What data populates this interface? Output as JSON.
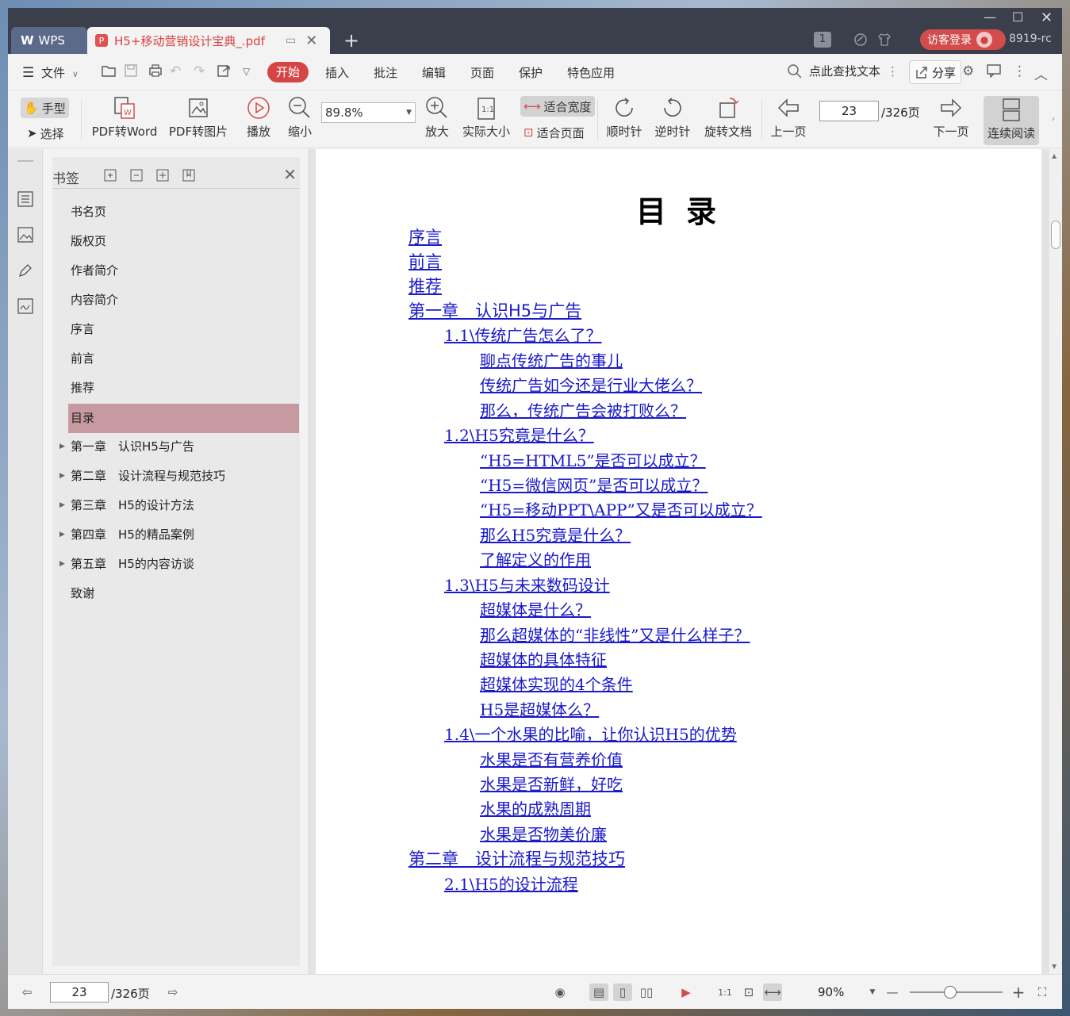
{
  "window": {
    "app_tab": "WPS",
    "doc_tab": "H5+移动营销设计宝典_.pdf",
    "new_tab": "+",
    "badge": "1",
    "login": "访客登录",
    "user_id": "8919-rc"
  },
  "menu": {
    "file": "文件",
    "items": [
      "开始",
      "插入",
      "批注",
      "编辑",
      "页面",
      "保护",
      "特色应用"
    ],
    "search": "点此查找文本",
    "share": "分享"
  },
  "toolbar": {
    "hand": "手型",
    "select": "选择",
    "pdf_to_word": "PDF转Word",
    "pdf_to_image": "PDF转图片",
    "play": "播放",
    "zoom_out": "缩小",
    "zoom_value": "89.8%",
    "zoom_in": "放大",
    "actual_size": "实际大小",
    "fit_width": "适合宽度",
    "fit_page": "适合页面",
    "rotate_cw": "顺时针",
    "rotate_ccw": "逆时针",
    "rotate_doc": "旋转文档",
    "prev_page": "上一页",
    "page_current": "23",
    "page_total": "/326页",
    "next_page": "下一页",
    "continuous": "连续阅读"
  },
  "bookmarks": {
    "title": "书签",
    "items": [
      {
        "label": "书名页"
      },
      {
        "label": "版权页"
      },
      {
        "label": "作者简介"
      },
      {
        "label": "内容简介"
      },
      {
        "label": "序言"
      },
      {
        "label": "前言"
      },
      {
        "label": "推荐"
      },
      {
        "label": "目录"
      },
      {
        "label": "第一章　认识H5与广告"
      },
      {
        "label": "第二章　设计流程与规范技巧"
      },
      {
        "label": "第三章　H5的设计方法"
      },
      {
        "label": "第四章　H5的精品案例"
      },
      {
        "label": "第五章　H5的内容访谈"
      },
      {
        "label": "致谢"
      }
    ]
  },
  "document": {
    "title": "目 录",
    "toc": [
      {
        "text": "序言"
      },
      {
        "text": "前言"
      },
      {
        "text": "推荐"
      },
      {
        "text": "第一章　认识H5与广告"
      },
      {
        "text": "1.1\\传统广告怎么了？"
      },
      {
        "text": "聊点传统广告的事儿"
      },
      {
        "text": "传统广告如今还是行业大佬么？"
      },
      {
        "text": "那么，传统广告会被打败么？"
      },
      {
        "text": "1.2\\H5究竟是什么？"
      },
      {
        "text": "“H5=HTML5”是否可以成立？"
      },
      {
        "text": "“H5=微信网页”是否可以成立？"
      },
      {
        "text": "“H5=移动PPT\\APP”又是否可以成立？"
      },
      {
        "text": "那么H5究竟是什么？"
      },
      {
        "text": "了解定义的作用"
      },
      {
        "text": "1.3\\H5与未来数码设计"
      },
      {
        "text": "超媒体是什么？"
      },
      {
        "text": "那么超媒体的“非线性”又是什么样子？"
      },
      {
        "text": "超媒体的具体特征"
      },
      {
        "text": "超媒体实现的4个条件"
      },
      {
        "text": "H5是超媒体么？"
      },
      {
        "text": "1.4\\一个水果的比喻，让你认识H5的优势"
      },
      {
        "text": "水果是否有营养价值"
      },
      {
        "text": "水果是否新鲜，好吃"
      },
      {
        "text": "水果的成熟周期"
      },
      {
        "text": "水果是否物美价廉"
      },
      {
        "text": "第二章　设计流程与规范技巧"
      },
      {
        "text": "2.1\\H5的设计流程"
      }
    ]
  },
  "status": {
    "page_current": "23",
    "page_total": "/326页",
    "zoom": "90%"
  },
  "colors": {
    "accent": "#d64545",
    "link": "#1a1acb",
    "selected_bookmark": "#c79aa1",
    "titlebar": "#3a3f4b"
  }
}
